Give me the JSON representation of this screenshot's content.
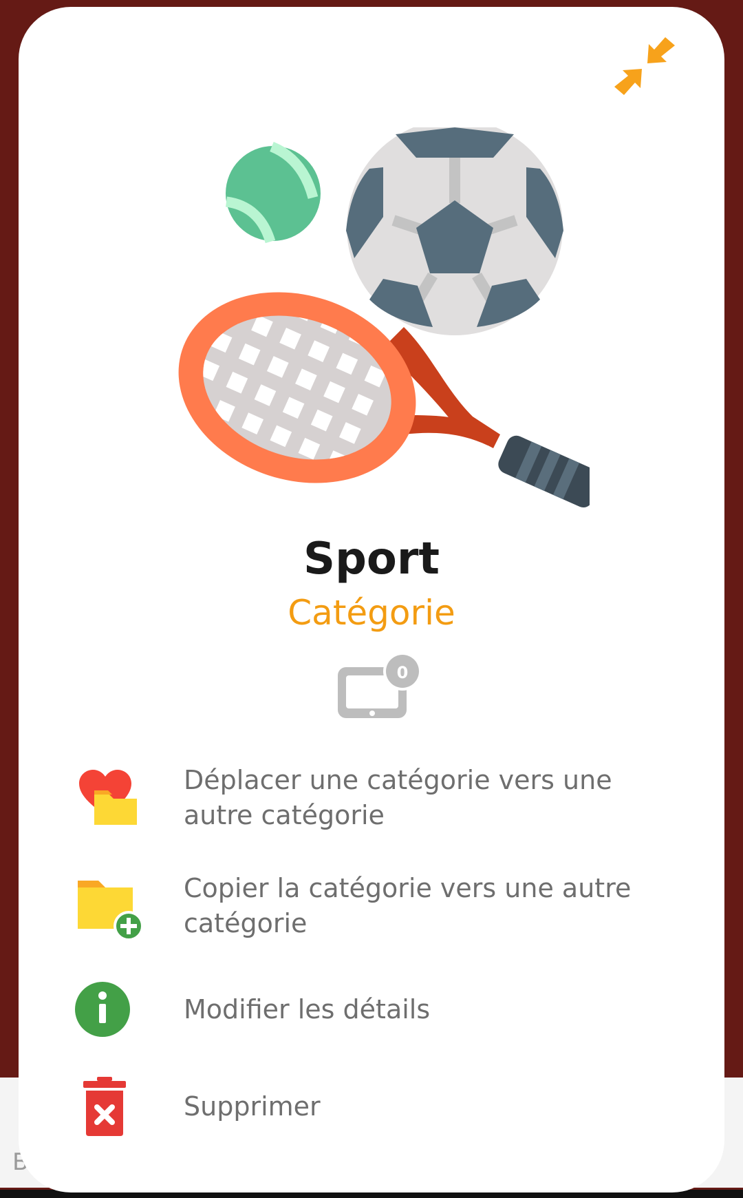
{
  "backdrop": {
    "text": "B"
  },
  "header": {
    "collapse_icon": "collapse-arrows-icon"
  },
  "category": {
    "name": "Sport",
    "type_label": "Catégorie",
    "hero_icon": "sports-equipment-icon",
    "device_count": "0"
  },
  "actions": [
    {
      "id": "move",
      "label": "Déplacer une catégorie vers une autre catégorie",
      "icon": "heart-folder-icon"
    },
    {
      "id": "copy",
      "label": "Copier la catégorie vers une autre catégorie",
      "icon": "folder-add-icon"
    },
    {
      "id": "edit",
      "label": "Modifier les détails",
      "icon": "info-icon"
    },
    {
      "id": "delete",
      "label": "Supprimer",
      "icon": "trash-icon"
    }
  ],
  "colors": {
    "accent": "#f39c12",
    "backdrop": "#651a15",
    "label": "#6e6e6e",
    "danger": "#e53935",
    "success": "#43a047"
  }
}
